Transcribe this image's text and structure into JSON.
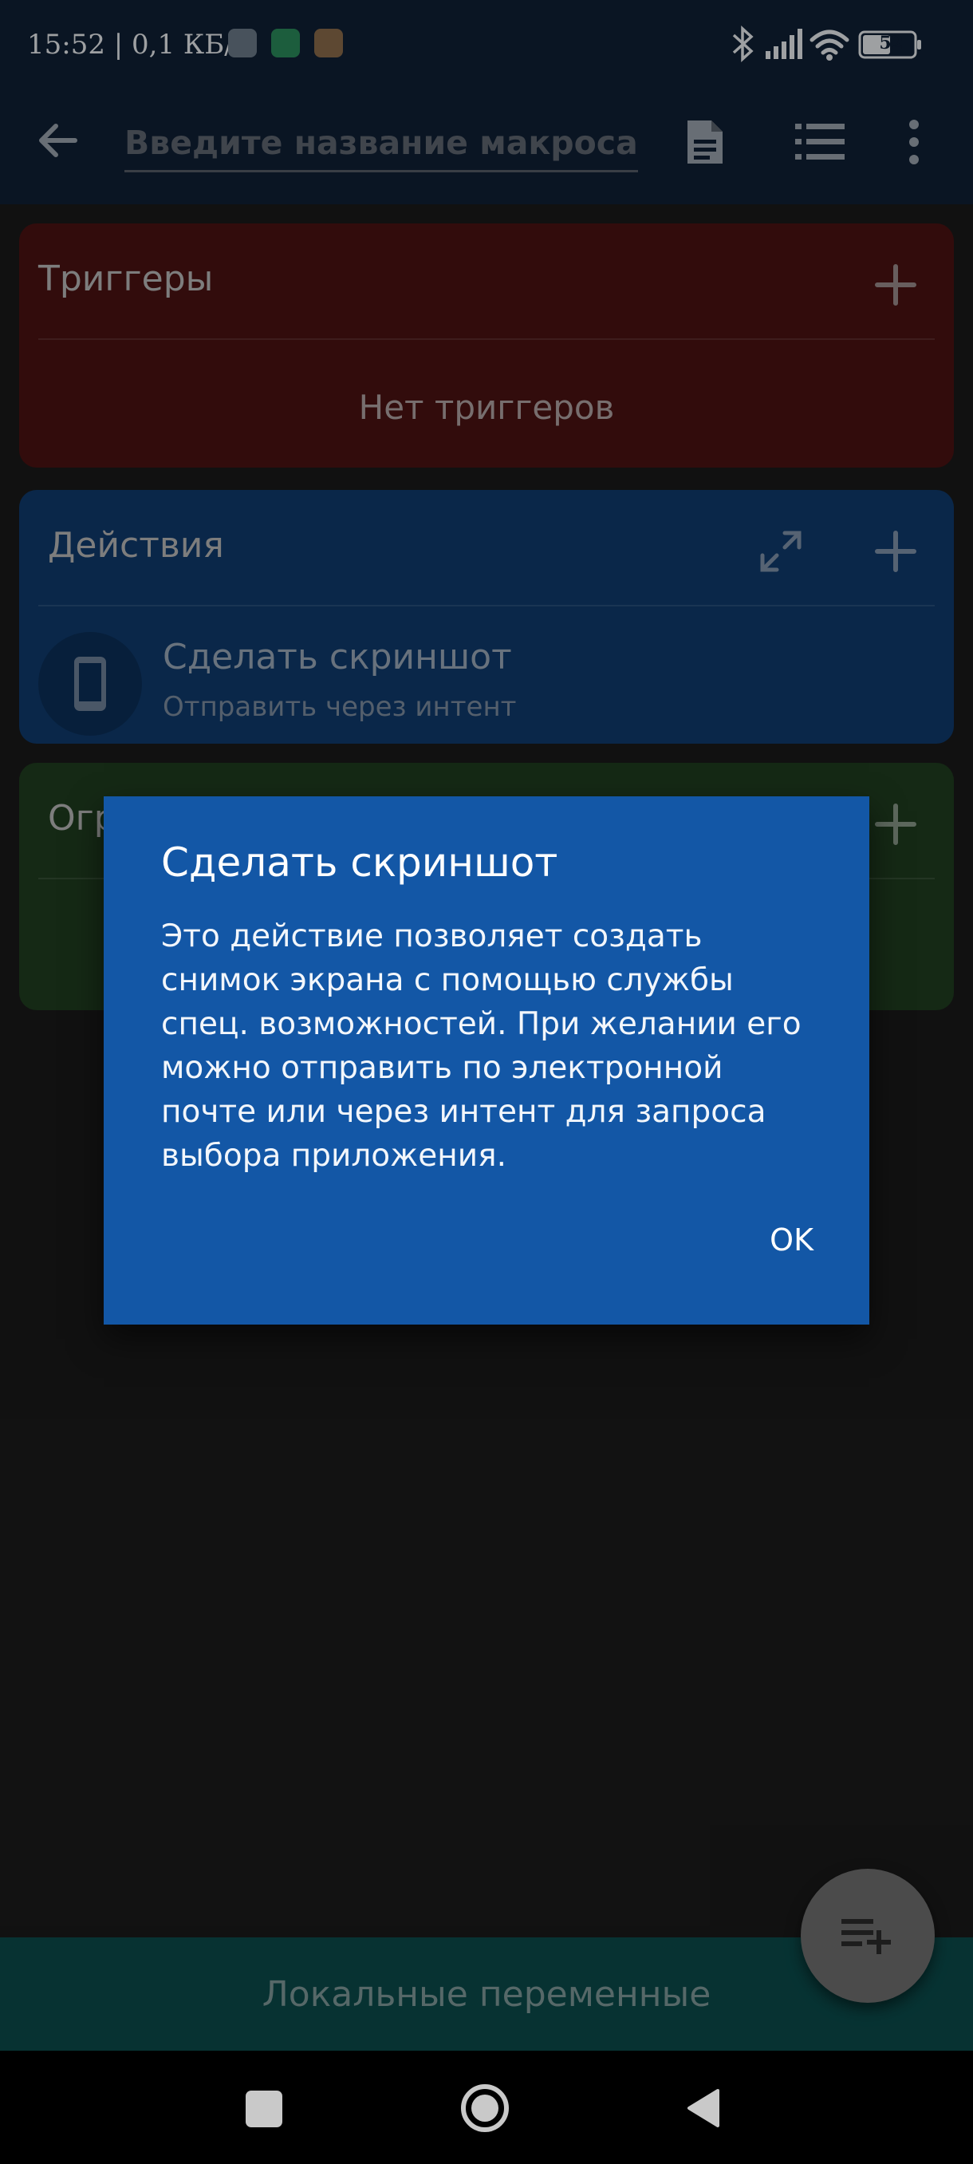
{
  "status": {
    "time_speed": "15:52 | 0,1 КБ/с",
    "battery": "52"
  },
  "toolbar": {
    "name_placeholder": "Введите название макроса"
  },
  "triggers": {
    "title": "Триггеры",
    "empty": "Нет триггеров",
    "color": "#4a1313"
  },
  "actions": {
    "title": "Действия",
    "item_title": "Сделать скриншот",
    "item_subtitle": "Отправить через интент",
    "color": "#0f3a6c"
  },
  "constraints": {
    "title_partial": "Огр",
    "color": "#1f3d1f"
  },
  "bottom": {
    "locals_label": "Локальные переменные"
  },
  "dialog": {
    "title": "Сделать скриншот",
    "body": "Это действие позволяет создать снимок экрана с помощью службы спец. возможностей. При желании его можно отправить по электронной почте или через интент для запроса выбора приложения.",
    "ok_label": "OK"
  }
}
